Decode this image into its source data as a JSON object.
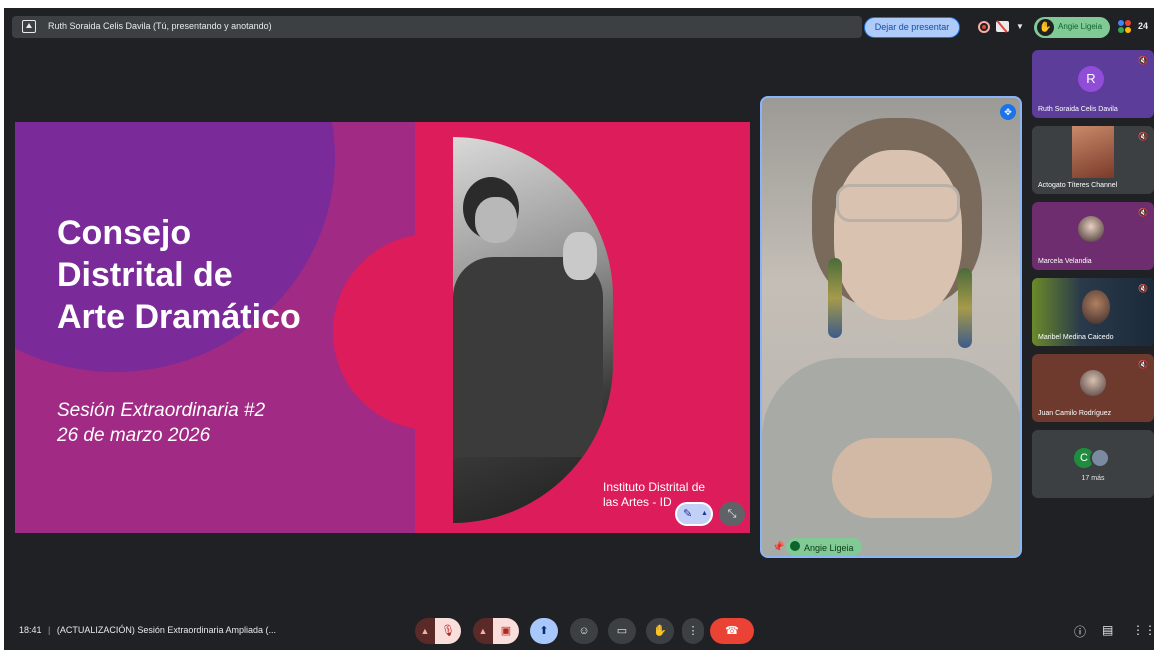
{
  "topbar": {
    "presenter_text": "Ruth Soraida Celis Davila (Tú, presentando y anotando)",
    "stop_presenting_label": "Dejar de presentar",
    "hand_raised_name": "Angie Ligeia",
    "participant_count": "24"
  },
  "slide": {
    "title_lines": [
      "Consejo",
      "Distrital de",
      "Arte Dramático"
    ],
    "subtitle_lines": [
      "Sesión Extraordinaria #2",
      "26 de marzo 2026"
    ],
    "institute_lines": [
      "Instituto Distrital de",
      "las Artes - ID"
    ]
  },
  "pinned": {
    "name": "Angie Ligeia"
  },
  "side_tiles": [
    {
      "name": "Ruth Soraida Celis Davila",
      "avatar_letter": "R",
      "bg": "#5c3d99"
    },
    {
      "name": "Actogato Títeres Channel",
      "bg": "#3c4043"
    },
    {
      "name": "Marcela Velandia",
      "bg": "#6e2d6e"
    },
    {
      "name": "Maribel Medina Caicedo",
      "bg": "#4a5a3a"
    },
    {
      "name": "Juan Camilo Rodríguez",
      "bg": "#6e3a2d"
    }
  ],
  "more": {
    "avatar_letter": "C",
    "label": "17 más"
  },
  "bottombar": {
    "time": "18:41",
    "separator": "|",
    "meeting_title": "(ACTUALIZACIÓN) Sesión Extraordinaria Ampliada (..."
  },
  "icons": {
    "mic": "mic-off-icon",
    "cam": "camera-off-icon",
    "present": "present-icon",
    "emoji": "emoji-icon",
    "captions": "captions-icon",
    "hand": "raise-hand-icon",
    "more": "more-vert-icon",
    "end": "end-call-icon",
    "info": "info-icon",
    "chat": "chat-icon",
    "apps": "apps-icon"
  },
  "colors": {
    "slide_magenta": "#dd1c5b",
    "slide_purple": "#a12a84",
    "accent_blue": "#8ab4f8",
    "hand_green": "#81c995",
    "end_red": "#ea4335"
  }
}
